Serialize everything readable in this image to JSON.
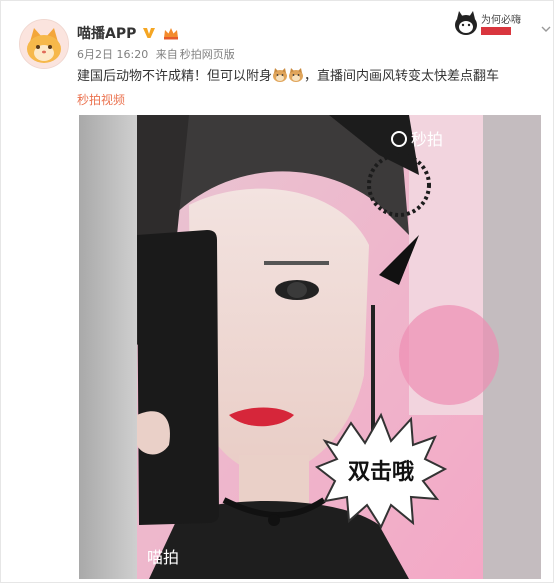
{
  "post": {
    "username": "喵播APP",
    "date": "6月2日 16:20",
    "source_prefix": "来自",
    "source": "秒拍网页版",
    "text_part1": "建国后动物不许成精！但可以附身",
    "text_part2": "，直播间内画风转变太快差点翻车",
    "video_link": "秒拍视频"
  },
  "stamp": {
    "text": "为何必嗨"
  },
  "video": {
    "watermark_top": "秒拍",
    "watermark_bottom": "喵拍",
    "bubble_text": "双击哦"
  },
  "icons": {
    "avatar": "cat-avatar-icon",
    "verified": "verified-v-icon",
    "member": "member-badge-icon",
    "emoji": "doge-emoji-icon",
    "dropdown": "chevron-down-icon"
  },
  "colors": {
    "link": "#eb7350",
    "verified": "#f5a623",
    "bg": "#ffffff"
  }
}
